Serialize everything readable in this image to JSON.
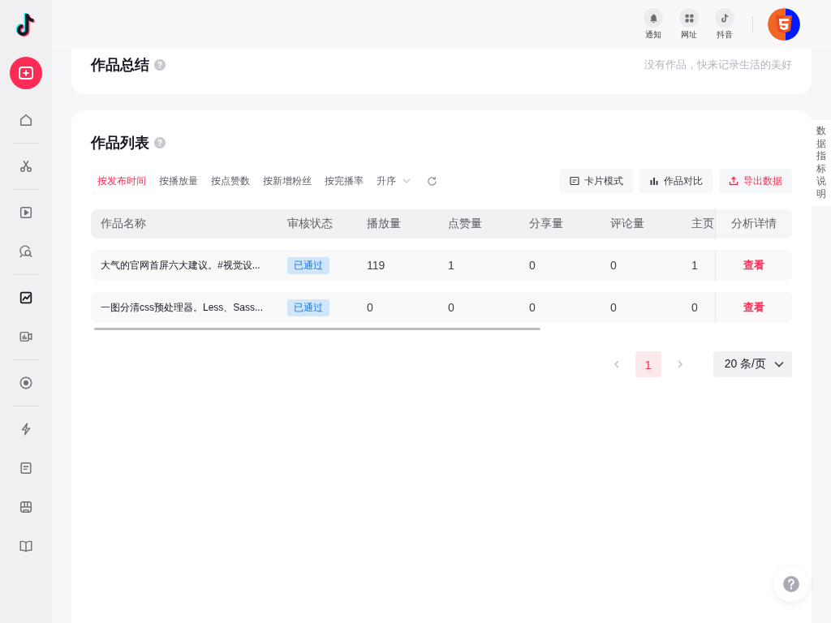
{
  "sidebar": {
    "create_selected": false,
    "groups": [
      [
        {
          "selected": false
        }
      ],
      [
        {
          "selected": false
        }
      ],
      [
        {
          "selected": false
        },
        {
          "selected": false
        }
      ],
      [
        {
          "selected": true
        },
        {
          "selected": false
        }
      ],
      [
        {
          "selected": false
        }
      ],
      [
        {
          "selected": false
        },
        {
          "selected": false
        },
        {
          "selected": false
        },
        {
          "selected": false
        }
      ]
    ]
  },
  "header": {
    "actions": [
      {
        "label": "通知"
      },
      {
        "label": "网址"
      },
      {
        "label": "抖音"
      }
    ]
  },
  "summary": {
    "title": "作品总结",
    "hint": "没有作品，快来记录生活的美好"
  },
  "works": {
    "title": "作品列表",
    "sort_options": [
      {
        "label": "按发布时间",
        "selected": true
      },
      {
        "label": "按播放量",
        "selected": false
      },
      {
        "label": "按点赞数",
        "selected": false
      },
      {
        "label": "按新增粉丝",
        "selected": false
      },
      {
        "label": "按完播率",
        "selected": false
      }
    ],
    "order": "升序",
    "buttons": [
      {
        "label": "卡片模式",
        "kind": "card"
      },
      {
        "label": "作品对比",
        "kind": "compare"
      },
      {
        "label": "导出数据",
        "kind": "export"
      }
    ],
    "table": {
      "columns": [
        "作品名称",
        "审核状态",
        "播放量",
        "点赞量",
        "分享量",
        "评论量",
        "主页",
        "分析详情"
      ],
      "rows": [
        {
          "cells": [
            "大气的官网首屏六大建议。#视觉设...",
            "已通过",
            "119",
            "1",
            "0",
            "0",
            "1",
            "查看"
          ]
        },
        {
          "cells": [
            "一图分清css预处理器。Less、Sass...",
            "已通过",
            "0",
            "0",
            "0",
            "0",
            "0",
            "查看"
          ]
        }
      ]
    },
    "pagination": {
      "pages": [
        {
          "label": "1",
          "selected": true
        }
      ],
      "page_size": "20 条/页"
    }
  },
  "side_tab": "数据指标说明"
}
